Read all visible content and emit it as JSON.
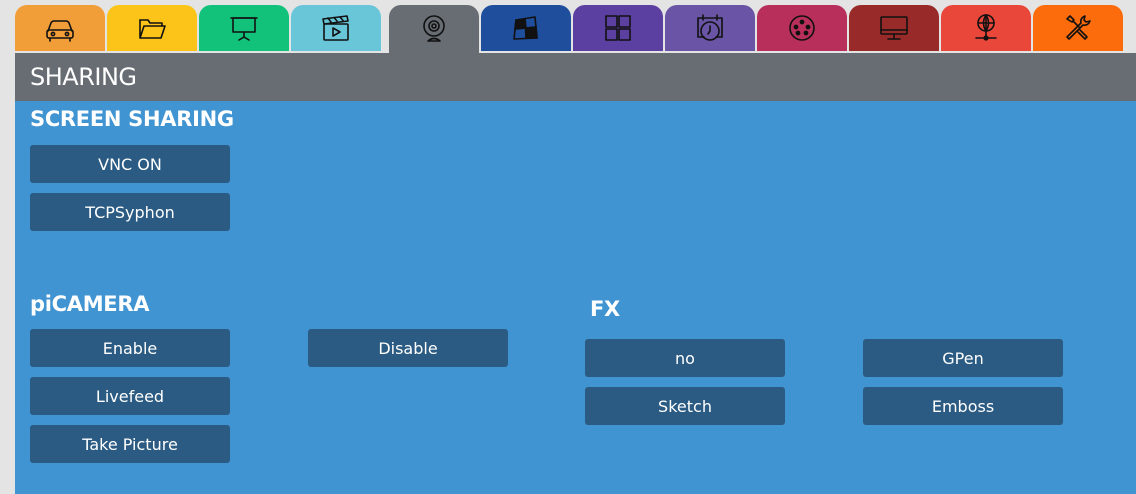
{
  "tabs": [
    {
      "name": "car-icon",
      "color": "#f19d38"
    },
    {
      "name": "folder-icon",
      "color": "#fcc419"
    },
    {
      "name": "projector-screen-icon",
      "color": "#13c27a"
    },
    {
      "name": "clapperboard-icon",
      "color": "#69c6d8"
    },
    {
      "name": "webcam-icon",
      "color": "#676d73",
      "active": true
    },
    {
      "name": "mapping-grid-icon",
      "color": "#1f4e9c"
    },
    {
      "name": "grid-icon",
      "color": "#5b3fa1"
    },
    {
      "name": "calendar-clock-icon",
      "color": "#6a54a6"
    },
    {
      "name": "dmx-connector-icon",
      "color": "#b82f5c"
    },
    {
      "name": "monitor-icon",
      "color": "#982a2a"
    },
    {
      "name": "network-icon",
      "color": "#e9473a"
    },
    {
      "name": "tools-icon",
      "color": "#fd6c0c"
    }
  ],
  "panel": {
    "title": "SHARING"
  },
  "screen_sharing": {
    "title": "SCREEN SHARING",
    "vnc_label": "VNC ON",
    "tcpsyphon_label": "TCPSyphon"
  },
  "picamera": {
    "title": "piCAMERA",
    "enable_label": "Enable",
    "livefeed_label": "Livefeed",
    "take_picture_label": "Take Picture",
    "disable_label": "Disable"
  },
  "fx": {
    "title": "FX",
    "no_label": "no",
    "gpen_label": "GPen",
    "sketch_label": "Sketch",
    "emboss_label": "Emboss"
  }
}
